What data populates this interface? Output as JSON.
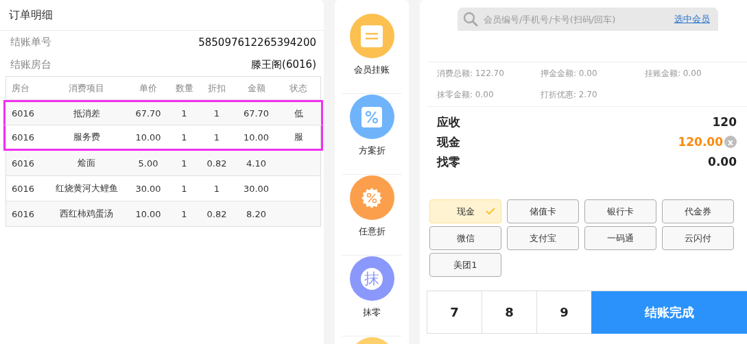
{
  "order": {
    "title": "订单明细",
    "info": [
      {
        "label": "结账单号",
        "value": "585097612265394200"
      },
      {
        "label": "结账房台",
        "value": "滕王阁(6016)"
      }
    ],
    "table": {
      "columns": [
        "房台",
        "消费项目",
        "单价",
        "数量",
        "折扣",
        "金额",
        "状态"
      ],
      "rows": [
        {
          "selected": true,
          "cells": [
            "6016",
            "抵消差",
            "67.70",
            "1",
            "1",
            "67.70",
            "低"
          ]
        },
        {
          "selected": true,
          "cells": [
            "6016",
            "服务费",
            "10.00",
            "1",
            "1",
            "10.00",
            "服"
          ]
        },
        {
          "selected": false,
          "cells": [
            "6016",
            "烩面",
            "5.00",
            "1",
            "0.82",
            "4.10"
          ]
        },
        {
          "selected": false,
          "cells": [
            "6016",
            "红烧黄河大鲤鱼",
            "30.00",
            "1",
            "1",
            "30.00"
          ]
        },
        {
          "selected": false,
          "cells": [
            "6016",
            "西红柿鸡蛋汤",
            "10.00",
            "1",
            "0.82",
            "8.20"
          ]
        }
      ]
    }
  },
  "actions": [
    {
      "kind": "list",
      "label": "会员挂账",
      "color": "#fbc04f"
    },
    {
      "kind": "percent-square",
      "label": "方案折",
      "color": "#6fb4fb"
    },
    {
      "kind": "percent-badge",
      "label": "任意折",
      "color": "#fc9f4c"
    },
    {
      "kind": "glyph",
      "glyph": "抹",
      "label": "抹零",
      "color": "#8b98fb"
    },
    {
      "kind": "partial",
      "color": "#fdd06b"
    }
  ],
  "member_search": {
    "placeholder": "会员编号/手机号/卡号(扫码/回车)",
    "link": "选中会员"
  },
  "summary": [
    "消费总额: 122.70",
    "押金金额: 0.00",
    "挂账金额: 0.00",
    "抹零金额: 0.00",
    "打折优惠: 2.70"
  ],
  "amounts": [
    {
      "kind": "plain",
      "label": "应收",
      "value": "120"
    },
    {
      "kind": "input",
      "label": "现金",
      "value": "120.00",
      "clear": "x"
    },
    {
      "kind": "plain",
      "label": "找零",
      "value": "0.00"
    }
  ],
  "payment_methods": [
    {
      "label": "现金",
      "selected": true
    },
    {
      "label": "储值卡",
      "selected": false
    },
    {
      "label": "银行卡",
      "selected": false
    },
    {
      "label": "代金券",
      "selected": false
    },
    {
      "label": "微信",
      "selected": false
    },
    {
      "label": "支付宝",
      "selected": false
    },
    {
      "label": "一码通",
      "selected": false
    },
    {
      "label": "云闪付",
      "selected": false
    },
    {
      "label": "美团1",
      "selected": false
    }
  ],
  "keypad": [
    "7",
    "8",
    "9"
  ],
  "confirm_button": "结账完成"
}
